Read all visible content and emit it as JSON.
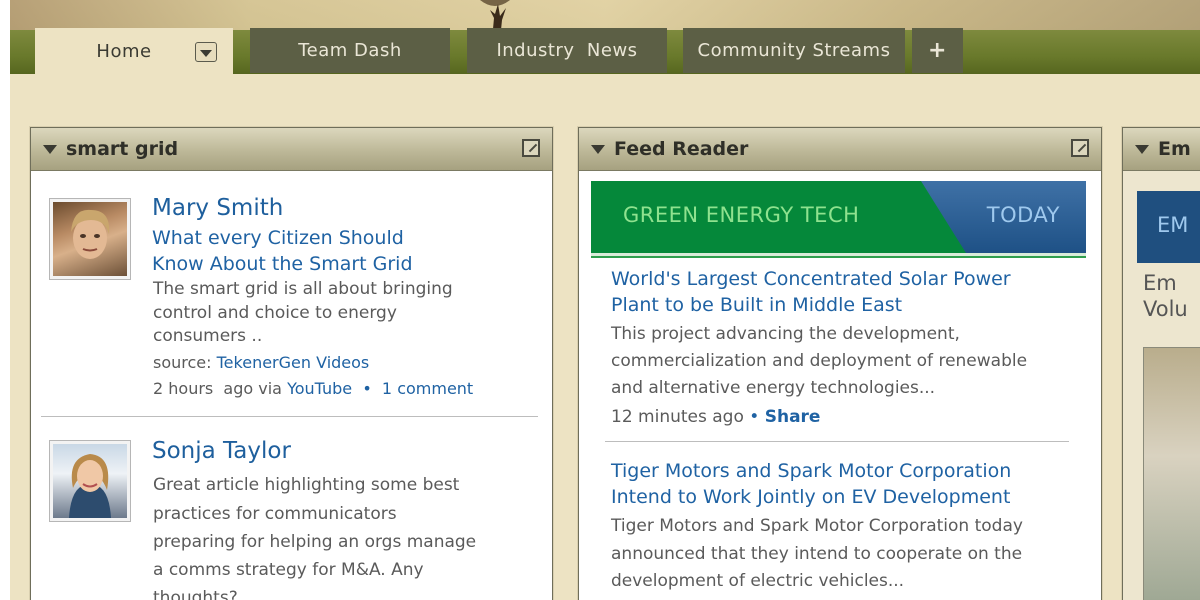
{
  "tabs": {
    "home": "Home",
    "team_dash": "Team Dash",
    "industry_news": "Industry  News",
    "community_streams": "Community Streams",
    "add": "+"
  },
  "panels": {
    "smart_grid": {
      "title": "smart grid",
      "entries": [
        {
          "author": "Mary Smith",
          "title_line1": "What every Citizen Should",
          "title_line2": "Know About the Smart Grid",
          "body_line1": "The smart grid is all about bringing",
          "body_line2": "control and choice to energy",
          "body_line3": "consumers ..",
          "source_label": "source:",
          "source_name": "TekenerGen Videos",
          "time": "2 hours  ago via",
          "via": "YouTube",
          "comments": "1 comment"
        },
        {
          "author": "Sonja Taylor",
          "body_line1": "Great article highlighting some best",
          "body_line2": "practices for communicators",
          "body_line3": "preparing for helping an orgs manage",
          "body_line4": "a comms strategy for M&A. Any",
          "body_line5": "thoughts?"
        }
      ]
    },
    "feed_reader": {
      "title": "Feed Reader",
      "banner_left": "GREEN ENERGY TECH",
      "banner_right": "TODAY",
      "items": [
        {
          "title_line1": "World's Largest Concentrated Solar Power",
          "title_line2": "Plant to be Built in Middle East",
          "body_line1": "This project advancing the development,",
          "body_line2": "commercialization and deployment of renewable",
          "body_line3": "and alternative energy technologies...",
          "time": "12 minutes ago",
          "share": "Share"
        },
        {
          "title_line1": "Tiger Motors and Spark Motor Corporation",
          "title_line2": "Intend to Work Jointly on EV Development",
          "body_line1": "Tiger Motors and Spark Motor Corporation today",
          "body_line2": "announced that they intend to cooperate on the",
          "body_line3": "development of electric vehicles..."
        }
      ]
    },
    "third": {
      "title": "Em",
      "banner": "EM",
      "line1": "Em",
      "line2": "Volu"
    }
  },
  "icons": {
    "collapse": "triangle-down-icon",
    "popout": "popout-icon",
    "dropdown": "chevron-down-icon"
  },
  "colors": {
    "link": "#1f62a3",
    "tab_bg": "#5c5f45",
    "page_bg": "#ede3c3",
    "banner_green": "#05883a",
    "banner_blue": "#1e5186"
  }
}
